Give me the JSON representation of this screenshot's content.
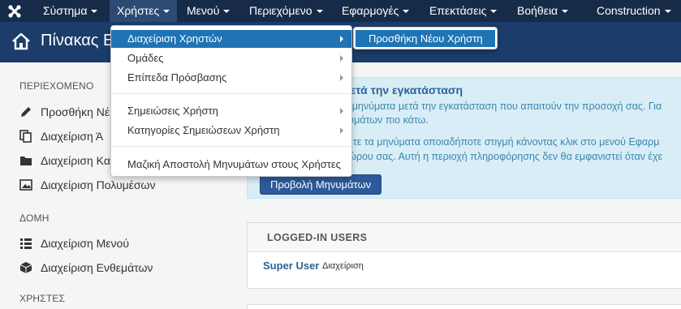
{
  "nav": {
    "items": [
      "Σύστημα",
      "Χρήστες",
      "Μενού",
      "Περιεχόμενο",
      "Εφαρμογές",
      "Επεκτάσεις",
      "Βοήθεια"
    ],
    "site": "Construction"
  },
  "header": {
    "title": "Πίνακας Ε"
  },
  "sidebar": {
    "sections": [
      {
        "heading": "ΠΕΡΙΕΧΟΜΕΝΟ",
        "items": [
          "Προσθήκη Νέ",
          "Διαχείριση Ά",
          "Διαχείριση Κα",
          "Διαχείριση Πολυμέσων"
        ]
      },
      {
        "heading": "ΔΟΜΗ",
        "items": [
          "Διαχείριση Μενού",
          "Διαχείριση Ενθεμάτων"
        ]
      },
      {
        "heading": "ΧΡΗΣΤΕΣ",
        "items": []
      }
    ]
  },
  "alert": {
    "title": "μετά την εγκατάσταση",
    "lines": [
      "α μηνύματα μετά την εγκατάσταση που απαιτούν την προσοχή σας. Για",
      "νυμάτων πιο κάτω.",
      "λετε τα μηνύματα οποιαδήποτε στιγμή κάνοντας κλικ στο μενού Εφαρμ",
      "χώρου σας. Αυτή η περιοχή πληροφόρησης δεν θα εμφανιστεί όταν έχε"
    ],
    "button": "Προβολή Μηνυμάτων"
  },
  "logged_in": {
    "heading": "LOGGED-IN USERS",
    "user": "Super User",
    "role": "Διαχείριση"
  },
  "dropdown": {
    "items": [
      {
        "label": "Διαχείριση Χρηστών",
        "submenu": true
      },
      {
        "label": "Ομάδες",
        "submenu": true
      },
      {
        "label": "Επίπεδα Πρόσβασης",
        "submenu": true
      },
      {
        "label": "Σημειώσεις Χρήστη",
        "submenu": true
      },
      {
        "label": "Κατηγορίες Σημειώσεων Χρήστη",
        "submenu": true
      },
      {
        "label": "Μαζική Αποστολή Μηνυμάτων στους Χρήστες",
        "submenu": false
      }
    ],
    "submenu_item": "Προσθήκη Νέου Χρήστη"
  },
  "colors": {
    "navbar": "#162b48",
    "header": "#1c3d6b",
    "accent": "#1e74b4"
  }
}
